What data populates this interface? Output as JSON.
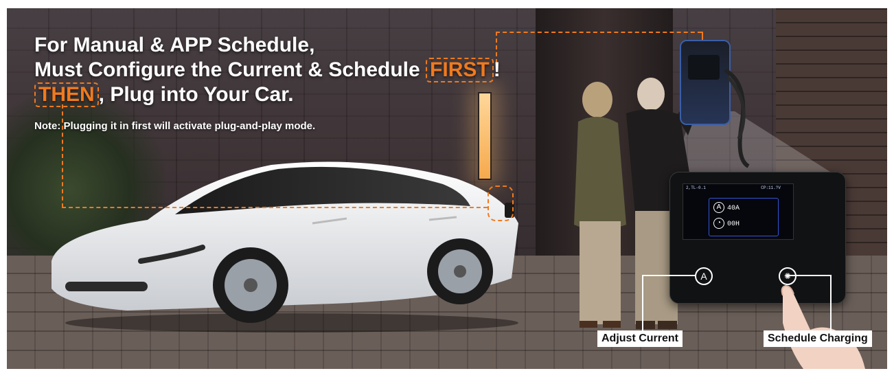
{
  "headline": {
    "line1": "For Manual & APP Schedule,",
    "line2_prefix": "Must Configure the Current & Schedule ",
    "line2_accent": "FIRST",
    "line2_suffix": "!",
    "line3_accent": "THEN",
    "line3_suffix": ", Plug into Your Car."
  },
  "note": "Note: Plugging it in first will activate plug-and-play mode.",
  "display": {
    "status_left": "2,TL-0.1",
    "status_right": "CP:11.?V",
    "current_icon": "A",
    "current_value": "40A",
    "schedule_value": "00H"
  },
  "buttons": {
    "adjust_icon": "A",
    "adjust_label": "Adjust Current",
    "schedule_label": "Schedule Charging"
  },
  "colors": {
    "accent": "#f07a1e",
    "display_border": "#3355d8",
    "charger_blue": "#3a5ea8"
  }
}
